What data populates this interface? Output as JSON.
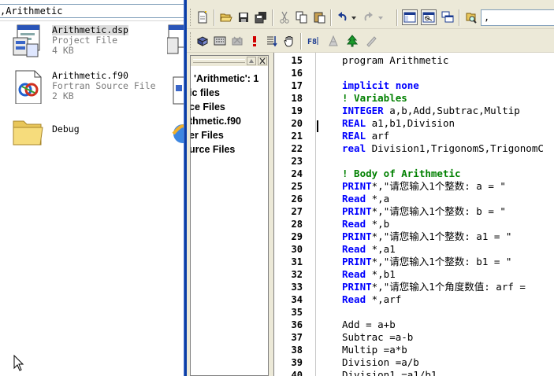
{
  "explorer": {
    "address": "Arithmetic",
    "files": [
      {
        "name": "Arithmetic.dsp",
        "type": "Project File",
        "size": "4 KB",
        "icon": "dsp-project-icon",
        "selected": true
      },
      {
        "name": "Arithmetic.f90",
        "type": "Fortran Source File",
        "size": "2 KB",
        "icon": "f90-source-icon",
        "selected": false
      },
      {
        "name": "Debug",
        "type": "",
        "size": "",
        "icon": "folder-icon",
        "selected": false
      }
    ]
  },
  "ide": {
    "find_value": ",",
    "toolbar1": [
      "new-file-icon",
      "open-icon",
      "save-icon",
      "save-all-icon",
      "cut-icon",
      "copy-icon",
      "paste-icon",
      "undo-icon",
      "redo-icon",
      "workspace-icon",
      "output-icon",
      "window-list-icon",
      "find-in-files-icon"
    ],
    "toolbar2": [
      "compile-icon",
      "build-icon",
      "stop-build-icon",
      "execute-icon",
      "go-icon",
      "breakpoint-hand-icon",
      "f8-help-icon",
      "wizard-icon",
      "tree-icon",
      "pencil-icon"
    ],
    "workspace": {
      "tree": [
        "'Arithmetic': 1",
        "ic files",
        "ce Files",
        "thmetic.f90",
        "er Files",
        "urce Files"
      ]
    },
    "editor": {
      "lines": [
        {
          "n": "15",
          "kw": "",
          "text": "program Arithmetic",
          "style": "plain"
        },
        {
          "n": "16",
          "kw": "",
          "text": "",
          "style": "plain"
        },
        {
          "n": "17",
          "kw": "implicit none",
          "text": "",
          "style": "kw"
        },
        {
          "n": "18",
          "kw": "! Variables",
          "text": "",
          "style": "cm"
        },
        {
          "n": "19",
          "kw": "INTEGER",
          "text": " a,b,Add,Subtrac,Multip",
          "style": "kw"
        },
        {
          "n": "20",
          "kw": "REAL",
          "text": " a1,b1,Division",
          "style": "kw"
        },
        {
          "n": "21",
          "kw": "REAL",
          "text": " arf",
          "style": "kw"
        },
        {
          "n": "22",
          "kw": "real",
          "text": " Division1,TrigonomS,TrigonomC",
          "style": "kw"
        },
        {
          "n": "23",
          "kw": "",
          "text": "",
          "style": "plain"
        },
        {
          "n": "24",
          "kw": "! Body of Arithmetic",
          "text": "",
          "style": "cm"
        },
        {
          "n": "25",
          "kw": "PRINT",
          "text": "*,\"请您输入1个整数: a = \"",
          "style": "kw"
        },
        {
          "n": "26",
          "kw": "Read",
          "text": " *,a",
          "style": "kw"
        },
        {
          "n": "27",
          "kw": "PRINT",
          "text": "*,\"请您输入1个整数: b = \"",
          "style": "kw"
        },
        {
          "n": "28",
          "kw": "Read",
          "text": " *,b",
          "style": "kw"
        },
        {
          "n": "29",
          "kw": "PRINT",
          "text": "*,\"请您输入1个整数: a1 = \"",
          "style": "kw"
        },
        {
          "n": "30",
          "kw": "Read",
          "text": " *,a1",
          "style": "kw"
        },
        {
          "n": "31",
          "kw": "PRINT",
          "text": "*,\"请您输入1个整数: b1 = \"",
          "style": "kw"
        },
        {
          "n": "32",
          "kw": "Read",
          "text": " *,b1",
          "style": "kw"
        },
        {
          "n": "33",
          "kw": "PRINT",
          "text": "*,\"请您输入1个角度数值: arf =",
          "style": "kw"
        },
        {
          "n": "34",
          "kw": "Read",
          "text": " *,arf",
          "style": "kw"
        },
        {
          "n": "35",
          "kw": "",
          "text": "",
          "style": "plain"
        },
        {
          "n": "36",
          "kw": "",
          "text": "Add = a+b",
          "style": "plain"
        },
        {
          "n": "37",
          "kw": "",
          "text": "Subtrac =a-b",
          "style": "plain"
        },
        {
          "n": "38",
          "kw": "",
          "text": "Multip =a*b",
          "style": "plain"
        },
        {
          "n": "39",
          "kw": "",
          "text": "Division =a/b",
          "style": "plain"
        },
        {
          "n": "40",
          "kw": "",
          "text": "Division1 =a1/b1",
          "style": "plain"
        }
      ]
    }
  }
}
